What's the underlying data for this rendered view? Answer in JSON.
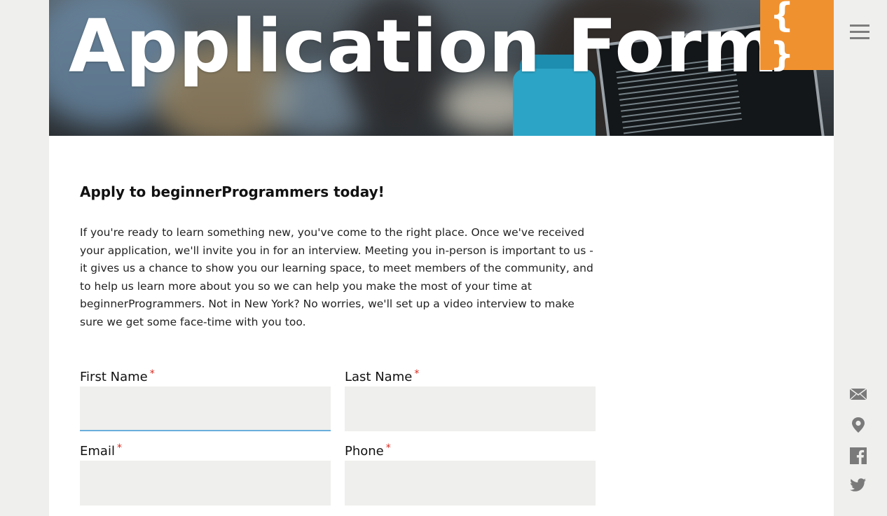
{
  "header": {
    "title": "Application Form",
    "logo_text": "{ }"
  },
  "nav": {
    "menu_icon": "hamburger-menu-icon"
  },
  "rail": {
    "icons": [
      "mail-icon",
      "map-pin-icon",
      "facebook-icon",
      "twitter-icon"
    ]
  },
  "main": {
    "headline": "Apply to beginnerProgrammers today!",
    "intro": "If you're ready to learn something new, you've come to the right place. Once we've received your application, we'll invite you in for an interview. Meeting you in-person is important to us - it gives us a chance to show you our learning space, to meet members of the community, and to help us learn more about you so we can help you make the most of your time at beginnerProgrammers. Not in New York? No worries, we'll set up a video interview to make sure we get some face-time with you too."
  },
  "form": {
    "required_mark": "*",
    "first_name": {
      "label": "First Name",
      "value": ""
    },
    "last_name": {
      "label": "Last Name",
      "value": ""
    },
    "email": {
      "label": "Email",
      "value": ""
    },
    "phone": {
      "label": "Phone",
      "value": ""
    }
  },
  "colors": {
    "accent": "#f0912f",
    "page_bg": "#efefee",
    "input_bg": "#efefed",
    "required": "#d9261c",
    "focus": "#6aaedb"
  }
}
